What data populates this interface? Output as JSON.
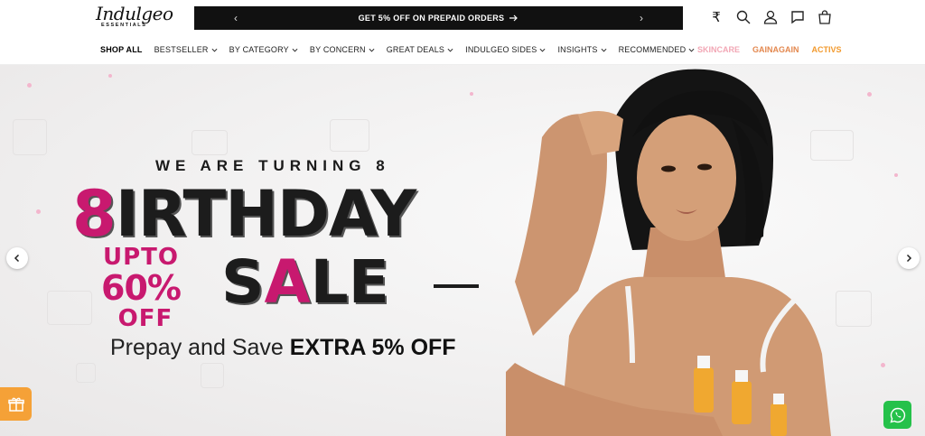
{
  "header": {
    "logo_text": "Indulgeo",
    "logo_sub": "ESSENTIALS",
    "promo_message": "GET 5% OFF ON PREPAID ORDERS",
    "promo_prev": "‹",
    "promo_next": "›",
    "icons": [
      "rupee-icon",
      "search-icon",
      "user-icon",
      "chat-icon",
      "cart-icon"
    ],
    "rupee_symbol": "₹"
  },
  "nav": {
    "items": [
      {
        "label": "SHOP ALL",
        "dropdown": false
      },
      {
        "label": "BESTSELLER",
        "dropdown": true
      },
      {
        "label": "BY CATEGORY",
        "dropdown": true
      },
      {
        "label": "BY CONCERN",
        "dropdown": true
      },
      {
        "label": "GREAT DEALS",
        "dropdown": true
      },
      {
        "label": "INDULGEO SIDES",
        "dropdown": true
      },
      {
        "label": "INSIGHTS",
        "dropdown": true
      },
      {
        "label": "RECOMMENDED",
        "dropdown": true
      }
    ],
    "brands": [
      {
        "label": "SKINCARE",
        "color": "#f2a7b5"
      },
      {
        "label": "GAINAGAIN",
        "color": "#e3884f"
      },
      {
        "label": "ACTIVS",
        "color": "#f29a2e"
      }
    ]
  },
  "hero": {
    "turning": "WE ARE TURNING 8",
    "birthday": "8IRTHDAY",
    "upto_1": "UPTO",
    "upto_2": "60%",
    "upto_3": "OFF",
    "sale": "SALE",
    "prepay_text": "Prepay and Save",
    "prepay_bold": "EXTRA 5% OFF",
    "accent_color": "#c8196f"
  },
  "floating": {
    "gift_icon": "gift-icon",
    "whatsapp_icon": "whatsapp-icon"
  }
}
